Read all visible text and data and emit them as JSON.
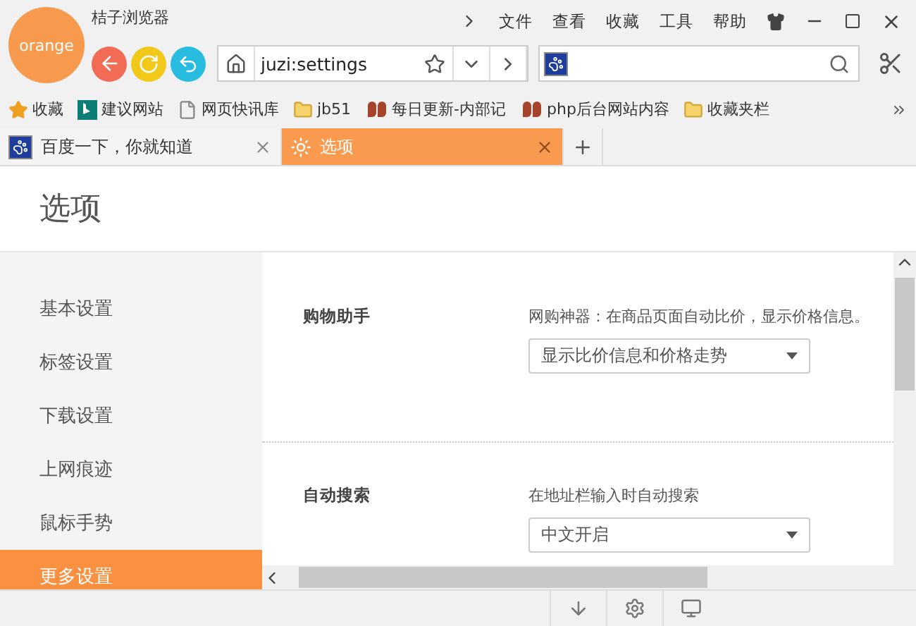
{
  "app": {
    "logo": "orange",
    "title": "桔子浏览器"
  },
  "menu": [
    "文件",
    "查看",
    "收藏",
    "工具",
    "帮助"
  ],
  "address": {
    "value": "juzi:settings"
  },
  "bookmarks": [
    {
      "label": "收藏",
      "kind": "star"
    },
    {
      "label": "建议网站",
      "kind": "bing"
    },
    {
      "label": "网页快讯库",
      "kind": "page"
    },
    {
      "label": "jb51",
      "kind": "folder"
    },
    {
      "label": "每日更新-内部记",
      "kind": "jb"
    },
    {
      "label": "php后台网站内容",
      "kind": "jb"
    },
    {
      "label": "收藏夹栏",
      "kind": "folder"
    }
  ],
  "tabs": [
    {
      "label": "百度一下，你就知道",
      "selected": false,
      "kind": "paw"
    },
    {
      "label": "选项",
      "selected": true,
      "kind": "sun"
    }
  ],
  "page": {
    "title": "选项",
    "sidebar": [
      {
        "label": "基本设置",
        "selected": false
      },
      {
        "label": "标签设置",
        "selected": false
      },
      {
        "label": "下载设置",
        "selected": false
      },
      {
        "label": "上网痕迹",
        "selected": false
      },
      {
        "label": "鼠标手势",
        "selected": false
      },
      {
        "label": "更多设置",
        "selected": true
      }
    ],
    "sections": [
      {
        "label": "购物助手",
        "description": "网购神器：在商品页面自动比价，显示价格信息。",
        "select": "显示比价信息和价格走势"
      },
      {
        "label": "自动搜索",
        "description": "在地址栏输入时自动搜索",
        "select": "中文开启"
      }
    ]
  }
}
